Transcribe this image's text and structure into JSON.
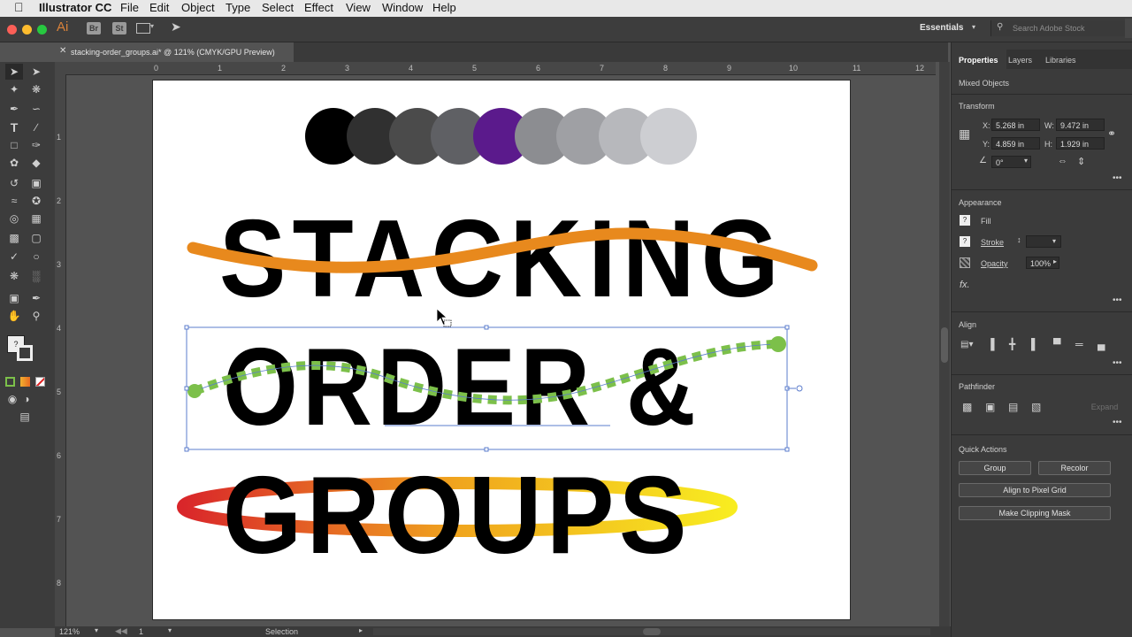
{
  "menubar": {
    "app_name": "Illustrator CC",
    "items": [
      "File",
      "Edit",
      "Object",
      "Type",
      "Select",
      "Effect",
      "View",
      "Window",
      "Help"
    ]
  },
  "appbar": {
    "ai_logo": "Ai",
    "bridge": "Br",
    "stock": "St",
    "workspace": "Essentials",
    "search_placeholder": "Search Adobe Stock"
  },
  "document": {
    "tab_title": "stacking-order_groups.ai* @ 121% (CMYK/GPU Preview)"
  },
  "ruler": {
    "h_ticks": [
      "0",
      "1",
      "2",
      "3",
      "4",
      "5",
      "6",
      "7",
      "8",
      "9",
      "10",
      "11",
      "12"
    ],
    "v_ticks": [
      "1",
      "2",
      "3",
      "4",
      "5",
      "6",
      "7",
      "8"
    ]
  },
  "artwork": {
    "line1": "STACKING",
    "line2": "ORDER &",
    "line3": "GROUPS",
    "circle_colors": [
      "#000000",
      "#303030",
      "#4b4b4b",
      "#5f6064",
      "#5b1a8c",
      "#8c8d91",
      "#9fa0a4",
      "#b7b8bc",
      "#cdced2"
    ],
    "orange": "#e8891d",
    "green": "#7cc04a",
    "selection_blue": "#5b7ccc"
  },
  "panel": {
    "tabs": [
      "Properties",
      "Layers",
      "Libraries"
    ],
    "selection_type": "Mixed Objects",
    "transform": {
      "heading": "Transform",
      "x_label": "X:",
      "x": "5.268 in",
      "y_label": "Y:",
      "y": "4.859 in",
      "w_label": "W:",
      "w": "9.472 in",
      "h_label": "H:",
      "h": "1.929 in",
      "angle": "0°"
    },
    "appearance": {
      "heading": "Appearance",
      "fill": "Fill",
      "stroke": "Stroke",
      "opacity_label": "Opacity",
      "opacity": "100%",
      "fx": "fx."
    },
    "align": {
      "heading": "Align"
    },
    "pathfinder": {
      "heading": "Pathfinder",
      "expand": "Expand"
    },
    "quick_actions": {
      "heading": "Quick Actions",
      "group": "Group",
      "recolor": "Recolor",
      "align_pixel": "Align to Pixel Grid",
      "clipping_mask": "Make Clipping Mask"
    },
    "more": "•••"
  },
  "status": {
    "zoom": "121%",
    "artboard": "1",
    "tool": "Selection"
  }
}
